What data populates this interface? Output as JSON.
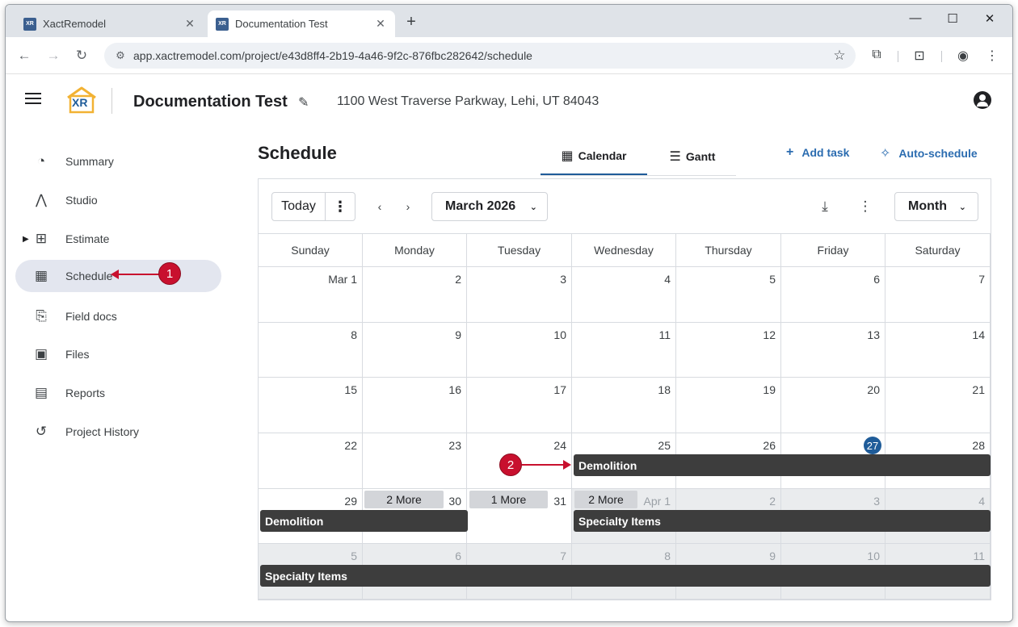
{
  "browser": {
    "tabs": [
      {
        "title": "XactRemodel",
        "active": false
      },
      {
        "title": "Documentation Test",
        "active": true
      }
    ],
    "url": "app.xactremodel.com/project/e43d8ff4-2b19-4a46-9f2c-876fbc282642/schedule"
  },
  "header": {
    "logo_text": "XR",
    "project_name": "Documentation Test",
    "project_address": "1100 West Traverse Parkway, Lehi, UT 84043"
  },
  "sidebar": {
    "items": [
      {
        "label": "Summary",
        "icon": "speedometer-icon"
      },
      {
        "label": "Studio",
        "icon": "compass-icon"
      },
      {
        "label": "Estimate",
        "icon": "calculator-icon"
      },
      {
        "label": "Schedule",
        "icon": "calendar-icon",
        "selected": true
      },
      {
        "label": "Field docs",
        "icon": "field-docs-icon"
      },
      {
        "label": "Files",
        "icon": "images-icon"
      },
      {
        "label": "Reports",
        "icon": "document-icon"
      },
      {
        "label": "Project History",
        "icon": "history-icon"
      }
    ]
  },
  "annotations": {
    "callout1": "1",
    "callout2": "2"
  },
  "main": {
    "title": "Schedule",
    "view_tabs": {
      "calendar": "Calendar",
      "gantt": "Gantt"
    },
    "add_task": "Add task",
    "auto_schedule": "Auto-schedule"
  },
  "calendar": {
    "today_label": "Today",
    "month_label": "March 2026",
    "view_label": "Month",
    "weekdays": [
      "Sunday",
      "Monday",
      "Tuesday",
      "Wednesday",
      "Thursday",
      "Friday",
      "Saturday"
    ],
    "weeks": [
      [
        "Mar 1",
        "2",
        "3",
        "4",
        "5",
        "6",
        "7"
      ],
      [
        "8",
        "9",
        "10",
        "11",
        "12",
        "13",
        "14"
      ],
      [
        "15",
        "16",
        "17",
        "18",
        "19",
        "20",
        "21"
      ],
      [
        "22",
        "23",
        "24",
        "25",
        "26",
        "27",
        "28"
      ],
      [
        "29",
        "30",
        "31",
        "Apr 1",
        "2",
        "3",
        "4"
      ],
      [
        "5",
        "6",
        "7",
        "8",
        "9",
        "10",
        "11"
      ]
    ],
    "today_date": "27",
    "more_chips": [
      "2 More",
      "1 More",
      "2 More"
    ],
    "events": [
      {
        "label": "Demolition",
        "color": "#3d3d3d"
      },
      {
        "label": "Demolition",
        "color": "#3d3d3d"
      },
      {
        "label": "Specialty Items",
        "color": "#3d3d3d"
      },
      {
        "label": "Specialty Items",
        "color": "#3d3d3d"
      }
    ]
  },
  "colors": {
    "accent": "#1f5c99",
    "callout": "#c8102e",
    "event": "#3d3d3d"
  }
}
